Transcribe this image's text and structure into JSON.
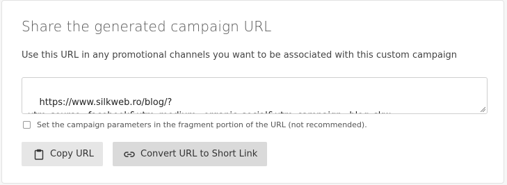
{
  "panel": {
    "title": "Share the generated campaign URL",
    "subtitle": "Use this URL in any promotional channels you want to be associated with this custom campaign"
  },
  "url_field": {
    "value": "https://www.silkweb.ro/blog/?\nutm_source=facebook&utm_medium=organic_social&utm_campaign=blog_skw"
  },
  "fragment_option": {
    "checked": false,
    "label": "Set the campaign parameters in the fragment portion of the URL (not recommended)."
  },
  "buttons": {
    "copy_label": "Copy URL",
    "copy_icon": "clipboard-icon",
    "short_label": "Convert URL to Short Link",
    "short_icon": "link-icon"
  }
}
